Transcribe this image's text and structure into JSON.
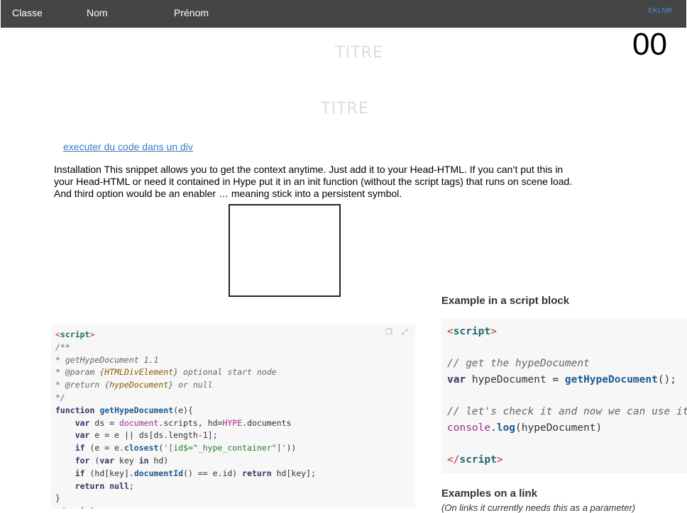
{
  "header": {
    "tabs": [
      "Classe",
      "Nom",
      "Prénom"
    ],
    "brand": "EKLNR"
  },
  "counter": "00",
  "titles": [
    "TITRE",
    "TITRE"
  ],
  "link_text": "executer du code dans un div",
  "intro_text": "Installation This snippet allows you to get the context anytime. Just add it to your Head-HTML. If you can’t put this in your Head-HTML or need it contained in Hype put it in an init function (without the script tags) that runs on scene load. And third option would be an enabler … meaning stick into a persistent symbol.",
  "code_left": {
    "toolbar_icons": [
      "copy-icon",
      "expand-icon"
    ]
  },
  "right": {
    "heading_script": "Example in a script block",
    "heading_link": "Examples on a link",
    "note": "(On links it currently needs this as a parameter)"
  }
}
